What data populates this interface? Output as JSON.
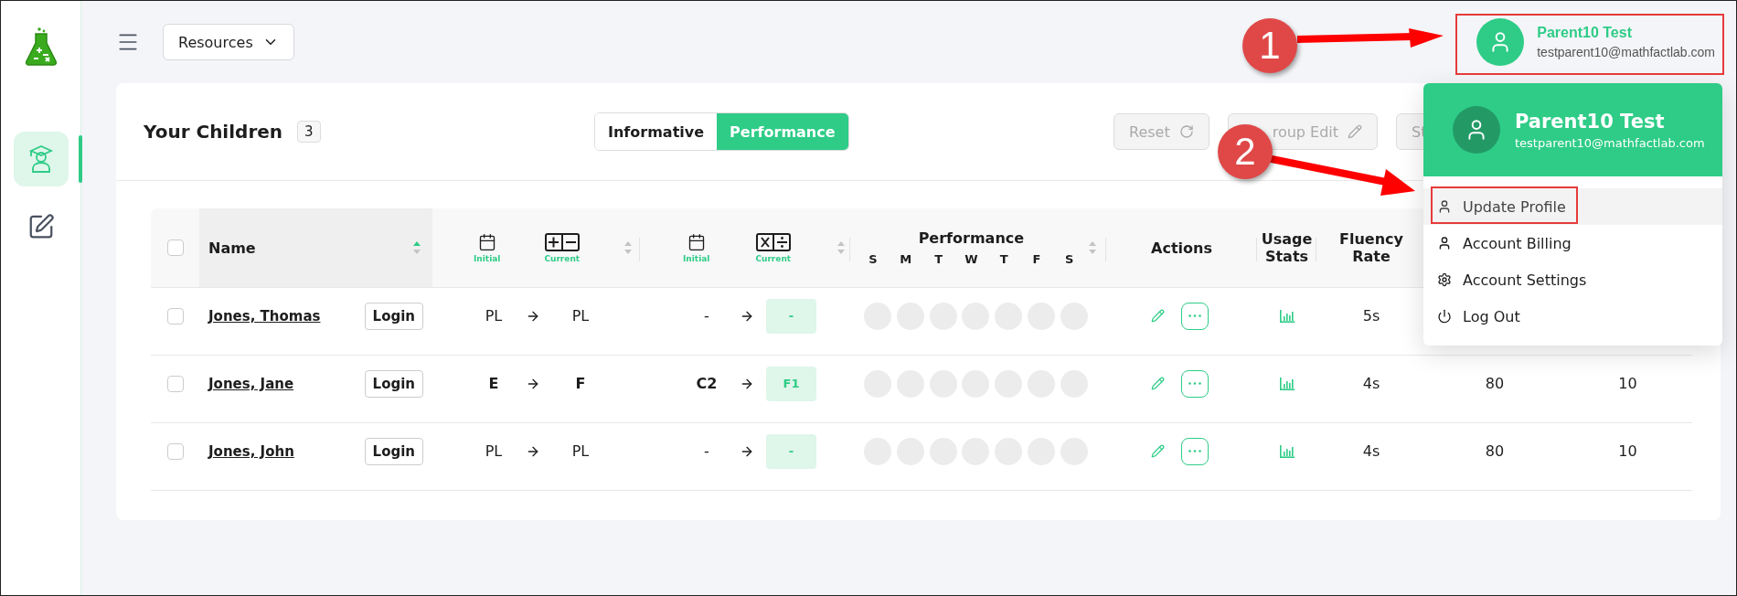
{
  "sidebar": {
    "items": [
      {
        "kind": "student",
        "selected": true
      },
      {
        "kind": "edit",
        "selected": false
      }
    ]
  },
  "topbar": {
    "resources_button": "Resources",
    "user": {
      "name": "Parent10 Test",
      "email": "testparent10@mathfactlab.com"
    }
  },
  "card": {
    "title": "Your Children",
    "count": "3",
    "view_toggle": [
      {
        "label": "Informative",
        "selected": false
      },
      {
        "label": "Performance",
        "selected": true
      }
    ],
    "actions": [
      {
        "kind": "reset",
        "label": "Reset",
        "disabled": true
      },
      {
        "kind": "edit",
        "label": "roup Edit",
        "disabled": true
      },
      {
        "kind": "plain",
        "label": "St",
        "disabled": true
      }
    ]
  },
  "table": {
    "header": {
      "select_all_checked": false,
      "name": {
        "label": "Name",
        "sorted": true
      },
      "addition": {
        "initial": "Initial",
        "current": "Current"
      },
      "multiplication": {
        "initial": "Initial",
        "current": "Current"
      },
      "performance": {
        "title": "Performance",
        "days": [
          "S",
          "M",
          "T",
          "W",
          "T",
          "F",
          "S"
        ]
      },
      "actions": "Actions",
      "usage": "Usage Stats",
      "fluency": "Fluency Rate"
    },
    "rows": [
      {
        "checked": false,
        "name": "Jones, Thomas",
        "login": "Login",
        "emphasized": false,
        "add_initial": "PL",
        "add_current": "PL",
        "mul_initial": "-",
        "mul_current": "-",
        "fluency": "5s"
      },
      {
        "checked": false,
        "name": "Jones, Jane",
        "login": "Login",
        "emphasized": true,
        "add_initial": "E",
        "add_current": "F",
        "mul_initial": "C2",
        "mul_current": "F1",
        "fluency": "4s",
        "column_9": "80",
        "column_10": "10"
      },
      {
        "checked": false,
        "name": "Jones, John",
        "login": "Login",
        "emphasized": false,
        "add_initial": "PL",
        "add_current": "PL",
        "mul_initial": "-",
        "mul_current": "-",
        "fluency": "4s",
        "column_9": "80",
        "column_10": "10"
      }
    ]
  },
  "dropdown": {
    "name": "Parent10 Test",
    "email": "testparent10@mathfactlab.com",
    "items": [
      {
        "kind": "user",
        "label": "Update Profile",
        "selected": true
      },
      {
        "kind": "user",
        "label": "Account Billing",
        "selected": false
      },
      {
        "kind": "settings",
        "label": "Account Settings",
        "selected": false
      },
      {
        "kind": "power",
        "label": "Log Out",
        "selected": false
      }
    ]
  },
  "annotations": [
    {
      "label": "1"
    },
    {
      "label": "2"
    }
  ]
}
